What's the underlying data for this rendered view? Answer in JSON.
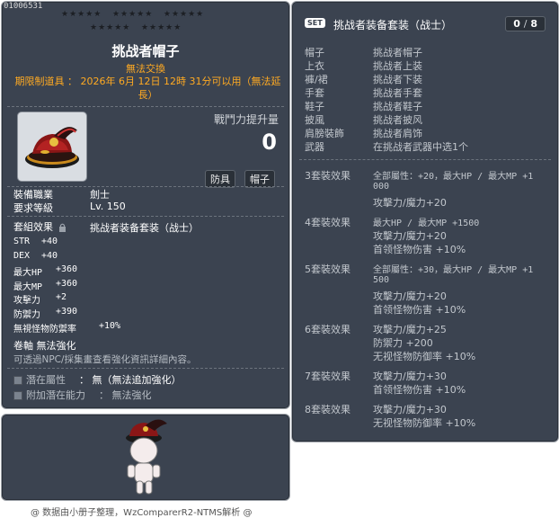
{
  "item": {
    "id": "01006531",
    "stars": [
      "★★★★★",
      "★★★★★",
      "★★★★★",
      "★★★★★",
      "★★★★★"
    ],
    "name": "挑战者帽子",
    "untradeable": "無法交換",
    "expire": "期限制道具 ： 2026年 6月 12日 12時 31分可以用（無法延長）",
    "power_label": "戰鬥力提升量",
    "power_value": "0",
    "tags": [
      "防具",
      "帽子"
    ],
    "req_job_label": "裝備職業",
    "req_job_value": "劍士",
    "req_level_label": "要求等級",
    "req_level_value": "Lv. 150",
    "set_label": "套組效果",
    "set_value": "挑战者装备套装（战士）",
    "stats": [
      {
        "label": "STR",
        "value": "+40"
      },
      {
        "label": "DEX",
        "value": "+40"
      },
      {
        "label": "最大HP",
        "value": "+360"
      },
      {
        "label": "最大MP",
        "value": "+360"
      },
      {
        "label": "攻擊力",
        "value": "+2"
      },
      {
        "label": "防禦力",
        "value": "+390"
      },
      {
        "label": "無視怪物防禦率",
        "value": "+10%"
      }
    ],
    "scroll_line": "卷軸 無法強化",
    "scroll_hint": "可透過NPC/採集畫查看強化資訊詳細內容。",
    "potential_label": "潛在屬性",
    "potential_value": "： 無（無法追加強化）",
    "addl_potential_label": "附加潛在能力",
    "addl_potential_value": "： 無法強化"
  },
  "set": {
    "badge": "SET",
    "name": "挑战者装备套装（战士）",
    "count_have": "0",
    "count_sep": "/",
    "count_total": "8",
    "pieces": [
      {
        "slot": "帽子",
        "item": "挑战者帽子"
      },
      {
        "slot": "上衣",
        "item": "挑战者上装"
      },
      {
        "slot": "褲/裙",
        "item": "挑战者下装"
      },
      {
        "slot": "手套",
        "item": "挑战者手套"
      },
      {
        "slot": "鞋子",
        "item": "挑战者鞋子"
      },
      {
        "slot": "披風",
        "item": "挑战者披风"
      },
      {
        "slot": "肩膀裝飾",
        "item": "挑战者肩饰"
      },
      {
        "slot": "武器",
        "item": "在挑战者武器中选1个"
      }
    ],
    "effects": [
      {
        "head": "3套裝效果",
        "lines": [
          "全部屬性：+20，最大HP / 最大MP  +1",
          "000",
          "攻擊力/魔力+20"
        ]
      },
      {
        "head": "4套裝效果",
        "lines": [
          "最大HP / 最大MP  +1500",
          "攻擊力/魔力+20",
          "首领怪物伤害 +10%"
        ]
      },
      {
        "head": "5套裝效果",
        "lines": [
          "全部屬性：+30，最大HP / 最大MP  +1",
          "500",
          "攻擊力/魔力+20",
          "首领怪物伤害 +10%"
        ]
      },
      {
        "head": "6套裝效果",
        "lines": [
          "攻擊力/魔力+25",
          "防禦力  +200",
          "无视怪物防御率 +10%"
        ]
      },
      {
        "head": "7套裝效果",
        "lines": [
          "攻擊力/魔力+30",
          "首领怪物伤害 +10%"
        ]
      },
      {
        "head": "8套裝效果",
        "lines": [
          "攻擊力/魔力+30",
          "无视怪物防御率 +10%"
        ]
      }
    ]
  },
  "footer": "@ 数据由小册子整理，WzComparerR2-NTMS解析 @",
  "colors": {
    "panel": "#3b4350",
    "border": "#9ea3aa",
    "orange": "#ffaa22",
    "grey_text": "#c2c7cd"
  },
  "icons": {
    "item": "hat-icon",
    "character": "character-preview",
    "set_badge": "set-badge",
    "lock": "lock-icon"
  }
}
